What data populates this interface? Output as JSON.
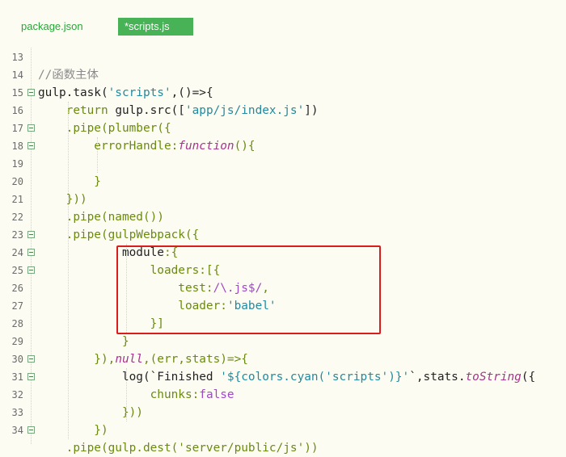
{
  "tabs": [
    {
      "label": "package.json",
      "active": false
    },
    {
      "label": "*scripts.js",
      "active": true
    }
  ],
  "lines": [
    {
      "n": "13",
      "fold": false,
      "segs": []
    },
    {
      "n": "14",
      "fold": false,
      "segs": [
        [
          "cm",
          "//函数主体"
        ]
      ]
    },
    {
      "n": "15",
      "fold": true,
      "segs": [
        [
          "plain",
          "gulp.task("
        ],
        [
          "str",
          "'scripts'"
        ],
        [
          "plain",
          ",()=>{"
        ]
      ]
    },
    {
      "n": "16",
      "fold": false,
      "segs": [
        [
          "kw",
          "    return "
        ],
        [
          "plain",
          "gulp.src(["
        ],
        [
          "str",
          "'app/js/index.js'"
        ],
        [
          "plain",
          "])"
        ]
      ]
    },
    {
      "n": "17",
      "fold": true,
      "segs": [
        [
          "kw",
          "    .pipe(plumber({"
        ]
      ]
    },
    {
      "n": "18",
      "fold": true,
      "segs": [
        [
          "kw",
          "        errorHandle:"
        ],
        [
          "fn",
          "function"
        ],
        [
          "kw",
          "(){"
        ]
      ]
    },
    {
      "n": "19",
      "fold": false,
      "segs": []
    },
    {
      "n": "20",
      "fold": false,
      "segs": [
        [
          "kw",
          "        }"
        ]
      ]
    },
    {
      "n": "21",
      "fold": false,
      "segs": [
        [
          "kw",
          "    }))"
        ]
      ]
    },
    {
      "n": "22",
      "fold": false,
      "segs": [
        [
          "kw",
          "    .pipe(named())"
        ]
      ]
    },
    {
      "n": "23",
      "fold": true,
      "segs": [
        [
          "kw",
          "    .pipe(gulpWebpack({"
        ]
      ]
    },
    {
      "n": "24",
      "fold": true,
      "segs": [
        [
          "plain",
          "            module"
        ],
        [
          "kw",
          ":{"
        ]
      ]
    },
    {
      "n": "25",
      "fold": true,
      "segs": [
        [
          "kw",
          "                loaders:[{"
        ]
      ]
    },
    {
      "n": "26",
      "fold": false,
      "segs": [
        [
          "kw",
          "                    test:"
        ],
        [
          "lit",
          "/\\.js$/"
        ],
        [
          "kw",
          ","
        ]
      ]
    },
    {
      "n": "27",
      "fold": false,
      "segs": [
        [
          "kw",
          "                    loader:"
        ],
        [
          "str",
          "'babel'"
        ]
      ]
    },
    {
      "n": "28",
      "fold": false,
      "segs": [
        [
          "kw",
          "                }]"
        ]
      ]
    },
    {
      "n": "29",
      "fold": false,
      "segs": [
        [
          "kw",
          "            }"
        ]
      ]
    },
    {
      "n": "30",
      "fold": true,
      "segs": [
        [
          "kw",
          "        }),"
        ],
        [
          "fn",
          "null"
        ],
        [
          "kw",
          ",(err,stats)=>{"
        ]
      ]
    },
    {
      "n": "31",
      "fold": true,
      "segs": [
        [
          "plain",
          "            log(`Finished "
        ],
        [
          "str",
          "'${colors.cyan('scripts')}'"
        ],
        [
          "plain",
          "`,stats."
        ],
        [
          "fn",
          "toString"
        ],
        [
          "plain",
          "({"
        ]
      ]
    },
    {
      "n": "32",
      "fold": false,
      "segs": [
        [
          "kw",
          "                chunks:"
        ],
        [
          "lit",
          "false"
        ]
      ]
    },
    {
      "n": "33",
      "fold": false,
      "segs": [
        [
          "kw",
          "            }))"
        ]
      ]
    },
    {
      "n": "34",
      "fold": true,
      "segs": [
        [
          "kw",
          "        })"
        ]
      ]
    },
    {
      "n": "",
      "fold": false,
      "segs": [
        [
          "kw",
          "    .pipe(gulp.dest('server/public/js'))"
        ]
      ]
    }
  ],
  "colors": {
    "background": "#fdfcf3",
    "tab_active": "#47b356",
    "tab_inactive_text": "#2ba33c",
    "highlight_box": "#d91c1c"
  }
}
